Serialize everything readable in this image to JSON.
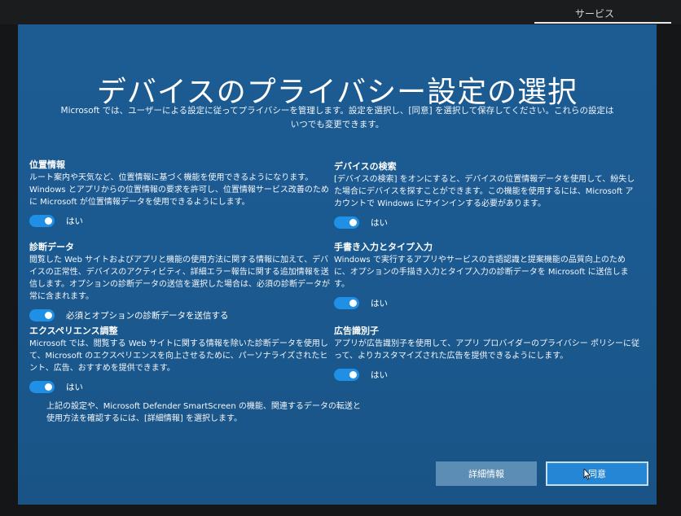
{
  "corner_tab": {
    "label": "サービス"
  },
  "page": {
    "title": "デバイスのプライバシー設定の選択",
    "subtitle": "Microsoft では、ユーザーによる設定に従ってプライバシーを管理します。設定を選択し、[同意] を選択して保存してください。これらの設定はいつでも変更できます。"
  },
  "settings": [
    {
      "title": "位置情報",
      "description": "ルート案内や天気など、位置情報に基づく機能を使用できるようになります。Windows とアプリからの位置情報の要求を許可し、位置情報サービス改善のために Microsoft が位置情報データを使用できるようにします。",
      "toggle_label": "はい",
      "on": true
    },
    {
      "title": "診断データ",
      "description": "閲覧した Web サイトおよびアプリと機能の使用方法に関する情報に加えて、デバイスの正常性、デバイスのアクティビティ、詳細エラー報告に関する追加情報を送信します。オプションの診断データの送信を選択した場合は、必須の診断データが常に含まれます。",
      "toggle_label": "必須とオプションの診断データを送信する",
      "on": true
    },
    {
      "title": "エクスペリエンス調整",
      "description": "Microsoft では、閲覧する Web サイトに関する情報を除いた診断データを使用して、Microsoft のエクスペリエンスを向上させるために、パーソナライズされたヒント、広告、おすすめを提供できます。",
      "toggle_label": "はい",
      "on": true
    },
    {
      "title": "デバイスの検索",
      "description": "[デバイスの検索] をオンにすると、デバイスの位置情報データを使用して、紛失した場合にデバイスを探すことができます。この機能を使用するには、Microsoft アカウントで Windows にサインインする必要があります。",
      "toggle_label": "はい",
      "on": true
    },
    {
      "title": "手書き入力とタイプ入力",
      "description": "Windows で実行するアプリやサービスの言語認識と提案機能の品質向上のために、オプションの手描き入力とタイプ入力の診断データを Microsoft に送信します。",
      "toggle_label": "はい",
      "on": true
    },
    {
      "title": "広告識別子",
      "description": "アプリが広告識別子を使用して、アプリ プロバイダーのプライバシー ポリシーに従って、よりカスタマイズされた広告を提供できるようにします。",
      "toggle_label": "はい",
      "on": true
    }
  ],
  "footer_note": "上記の設定や、Microsoft Defender SmartScreen の機能、関連するデータの転送と使用方法を確認するには、[詳細情報] を選択します。",
  "buttons": {
    "learn_more": "詳細情報",
    "accept": "同意"
  },
  "colors": {
    "background": "#1b5a91",
    "toggle_on": "#1f90e6",
    "accept_button": "#2586d6",
    "secondary_button": "#5b8db5"
  },
  "icons": {
    "pointer": "mouse-pointer-icon"
  }
}
